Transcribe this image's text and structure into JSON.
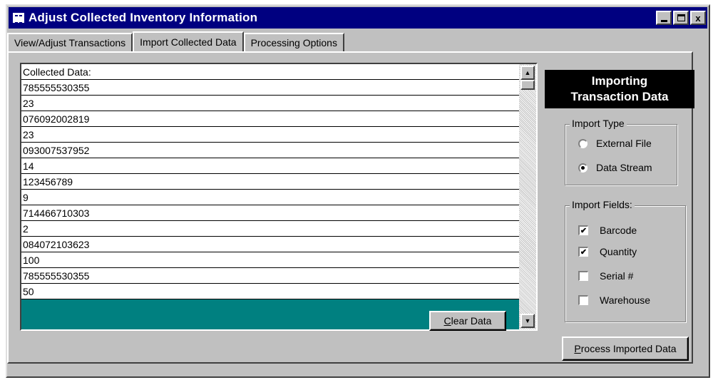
{
  "window": {
    "title": "Adjust Collected Inventory Information",
    "controls": {
      "minimize": "",
      "maximize": "",
      "close": "x"
    }
  },
  "tabs": [
    {
      "label": "View/Adjust Transactions",
      "active": false
    },
    {
      "label": "Import Collected Data",
      "active": true
    },
    {
      "label": "Processing Options",
      "active": false
    }
  ],
  "collected": {
    "header": "Collected Data:",
    "rows": [
      "785555530355",
      "23",
      "076092002819",
      "23",
      "093007537952",
      "14",
      "123456789",
      "9",
      "714466710303",
      "2",
      "084072103623",
      "100",
      "785555530355",
      "50"
    ],
    "clear_button": {
      "prefix": "",
      "accel": "C",
      "rest": "lear Data"
    }
  },
  "import_panel": {
    "title_line1": "Importing",
    "title_line2": "Transaction Data",
    "import_type": {
      "legend": "Import Type",
      "options": [
        {
          "label": "External File",
          "selected": false
        },
        {
          "label": "Data Stream",
          "selected": true
        }
      ]
    },
    "import_fields": {
      "legend": "Import Fields:",
      "fields": [
        {
          "label": "Barcode",
          "checked": true
        },
        {
          "label": "Quantity",
          "checked": true
        },
        {
          "label": "Serial #",
          "checked": false
        },
        {
          "label": "Warehouse",
          "checked": false
        }
      ]
    },
    "process_button": {
      "accel": "P",
      "rest": "rocess Imported Data"
    }
  },
  "colors": {
    "titlebar": "#000080",
    "list_background": "#008080",
    "face": "#c0c0c0"
  }
}
